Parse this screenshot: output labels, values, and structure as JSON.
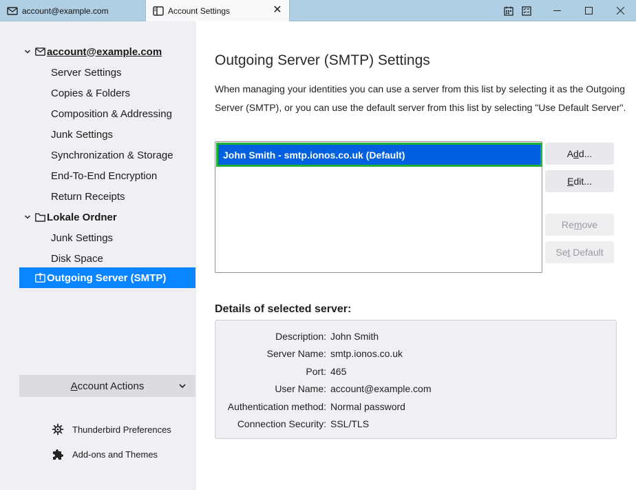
{
  "titlebar": {
    "tabs": [
      {
        "label": "account@example.com",
        "icon": "mail-icon",
        "active": false
      },
      {
        "label": "Account Settings",
        "icon": "settings-page-icon",
        "active": true
      }
    ],
    "close_glyph": "✕",
    "system_icons": [
      "calendar-icon",
      "tasks-icon"
    ]
  },
  "sidebar": {
    "accounts": [
      {
        "label": "account@example.com",
        "icon": "mail-icon",
        "items": [
          {
            "label": "Server Settings"
          },
          {
            "label": "Copies & Folders"
          },
          {
            "label": "Composition & Addressing"
          },
          {
            "label": "Junk Settings"
          },
          {
            "label": "Synchronization & Storage"
          },
          {
            "label": "End-To-End Encryption"
          },
          {
            "label": "Return Receipts"
          }
        ]
      },
      {
        "label": "Lokale Ordner",
        "icon": "folder-icon",
        "items": [
          {
            "label": "Junk Settings"
          },
          {
            "label": "Disk Space"
          }
        ]
      }
    ],
    "outgoing_server": {
      "label": "Outgoing Server (SMTP)",
      "icon": "outgoing-server-icon",
      "selected": true
    },
    "account_actions": {
      "label_pre": "",
      "label_accel": "A",
      "label_post": "ccount Actions"
    },
    "links": [
      {
        "label": "Thunderbird Preferences",
        "icon": "gear-icon"
      },
      {
        "label": "Add-ons and Themes",
        "icon": "puzzle-icon"
      }
    ]
  },
  "main": {
    "title": "Outgoing Server (SMTP) Settings",
    "description": "When managing your identities you can use a server from this list by selecting it as the Outgoing Server (SMTP), or you can use the default server from this list by selecting \"Use Default Server\".",
    "servers": [
      {
        "label": "John Smith - smtp.ionos.co.uk (Default)",
        "selected": true
      }
    ],
    "buttons": {
      "add": {
        "pre": "A",
        "accel": "d",
        "post": "d..."
      },
      "edit": {
        "pre": "",
        "accel": "E",
        "post": "dit..."
      },
      "remove": {
        "pre": "Re",
        "accel": "m",
        "post": "ove"
      },
      "set_default": {
        "pre": "Se",
        "accel": "t",
        "post": " Default"
      }
    },
    "details": {
      "heading": "Details of selected server:",
      "rows": [
        {
          "label": "Description:",
          "value": "John Smith"
        },
        {
          "label": "Server Name:",
          "value": "smtp.ionos.co.uk"
        },
        {
          "label": "Port:",
          "value": "465"
        },
        {
          "label": "User Name:",
          "value": "account@example.com"
        },
        {
          "label": "Authentication method:",
          "value": "Normal password"
        },
        {
          "label": "Connection Security:",
          "value": "SSL/TLS"
        }
      ]
    }
  },
  "colors": {
    "titlebar": "#b1cfe4",
    "sidebar_bg": "#f0f0f4",
    "selection": "#0a84ff",
    "list_selection": "#0060df",
    "focus_outline": "#1fb335"
  }
}
